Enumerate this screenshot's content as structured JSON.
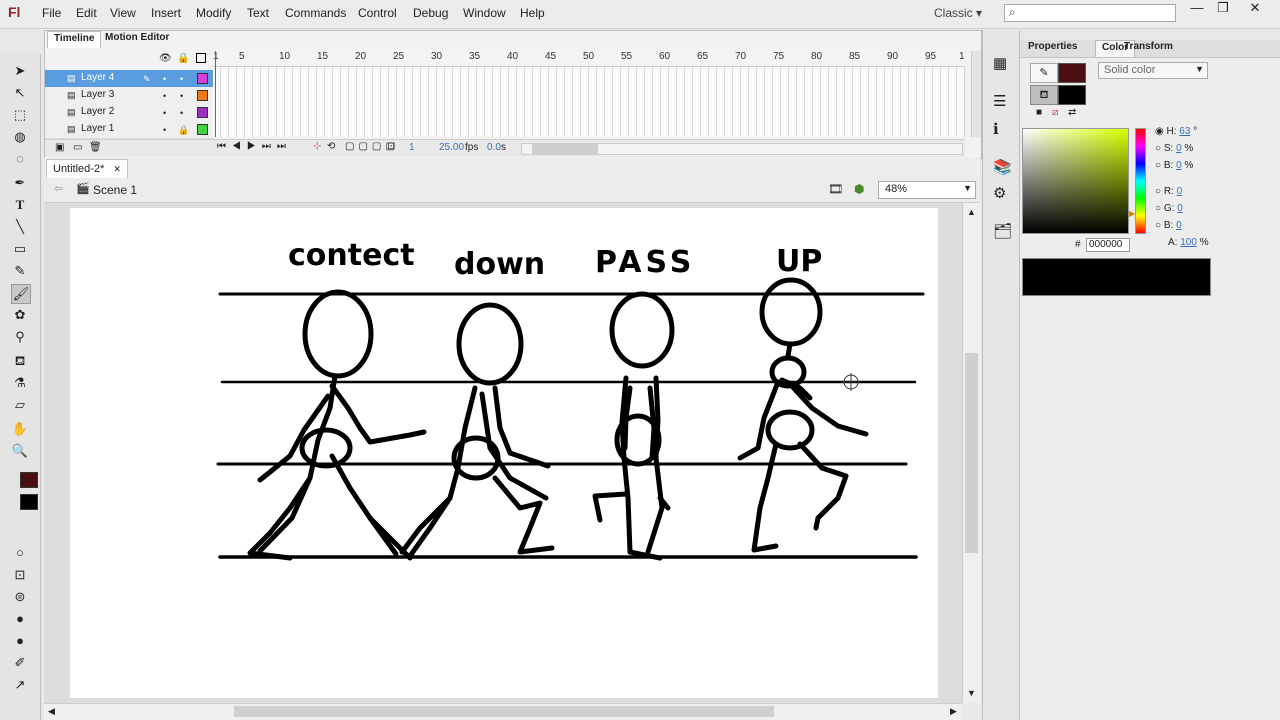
{
  "app": {
    "logo": "Fl",
    "workspace": "Classic ▾",
    "search_icon": "⌕"
  },
  "menu": [
    "File",
    "Edit",
    "View",
    "Insert",
    "Modify",
    "Text",
    "Commands",
    "Control",
    "Debug",
    "Window",
    "Help"
  ],
  "window_buttons": [
    "—",
    "❐",
    "✕"
  ],
  "timeline": {
    "tabs": [
      "Timeline",
      "Motion Editor"
    ],
    "layers": [
      {
        "name": "Layer 4",
        "color": "#d640d6",
        "selected": true
      },
      {
        "name": "Layer 3",
        "color": "#f07a1a"
      },
      {
        "name": "Layer 2",
        "color": "#9a2fc2"
      },
      {
        "name": "Layer 1",
        "color": "#43d443",
        "locked": true
      }
    ],
    "ruler": [
      "1",
      "5",
      "10",
      "15",
      "20",
      "25",
      "30",
      "35",
      "40",
      "45",
      "50",
      "55",
      "60",
      "65",
      "70",
      "75",
      "80",
      "85",
      "90",
      "95",
      "1"
    ],
    "footer": {
      "frame": "1",
      "fps": "25.00",
      "fps_unit": "fps",
      "time": "0.0",
      "time_unit": "s"
    }
  },
  "document": {
    "tab": "Untitled-2*",
    "close": "✕",
    "scene": "Scene 1",
    "zoom": "48%"
  },
  "stage": {
    "labels": [
      "contect",
      "down",
      "PASS",
      "UP"
    ]
  },
  "color_panel": {
    "tabs": [
      "Properties",
      "Color",
      "Transform"
    ],
    "type": "Solid color",
    "stroke_color": "#4a0f12",
    "fill_color": "#000000",
    "hsb": [
      {
        "k": "H:",
        "v": "63",
        "u": "°"
      },
      {
        "k": "S:",
        "v": "0",
        "u": "%"
      },
      {
        "k": "B:",
        "v": "0",
        "u": "%"
      }
    ],
    "rgb": [
      {
        "k": "R:",
        "v": "0"
      },
      {
        "k": "G:",
        "v": "0"
      },
      {
        "k": "B:",
        "v": "0"
      }
    ],
    "hex_label": "#",
    "hex": "000000",
    "alpha_label": "A:",
    "alpha": "100",
    "alpha_unit": "%"
  }
}
